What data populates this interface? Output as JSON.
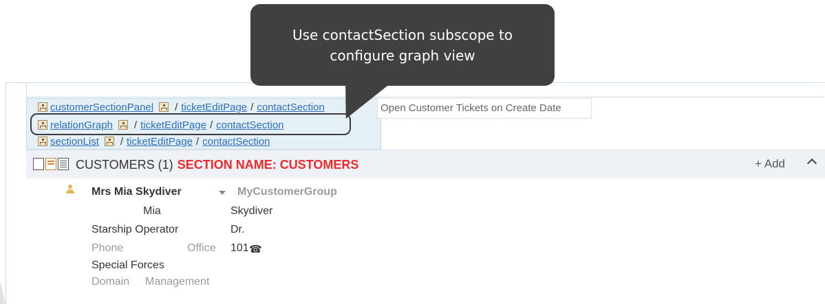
{
  "tooltip": {
    "line1": "Use contactSection subscope to",
    "line2": "configure graph view"
  },
  "scopes": [
    {
      "name": "customerSectionPanel",
      "path1": "ticketEditPage",
      "path2": "contactSection"
    },
    {
      "name": "relationGraph",
      "path1": "ticketEditPage",
      "path2": "contactSection"
    },
    {
      "name": "sectionList",
      "path1": "ticketEditPage",
      "path2": "contactSection"
    }
  ],
  "separator": "/",
  "search_field": {
    "value": "Open Customer Tickets on Create Date"
  },
  "section": {
    "title": "CUSTOMERS (1)",
    "name_note": "SECTION NAME: CUSTOMERS",
    "add_label": "+ Add"
  },
  "contact": {
    "name": "Mrs Mia Skydiver",
    "group": "MyCustomerGroup",
    "first_name": "Mia",
    "last_name": "Skydiver",
    "role": "Starship Operator",
    "title": "Dr.",
    "phone_label": "Phone",
    "phone_type": "Office",
    "phone_number": "101",
    "unit": "Special Forces",
    "domain_label": "Domain",
    "domain_value": "Management"
  },
  "colors": {
    "tooltip_bg": "#404040",
    "scope_bg": "#e4eff6",
    "section_note": "#ee2a2a",
    "link": "#2d6fb8"
  },
  "icons": [
    "hierarchy-icon",
    "view-mode-icon",
    "person-icon",
    "phone-icon",
    "chevron-up-icon",
    "dropdown-arrow-icon"
  ]
}
